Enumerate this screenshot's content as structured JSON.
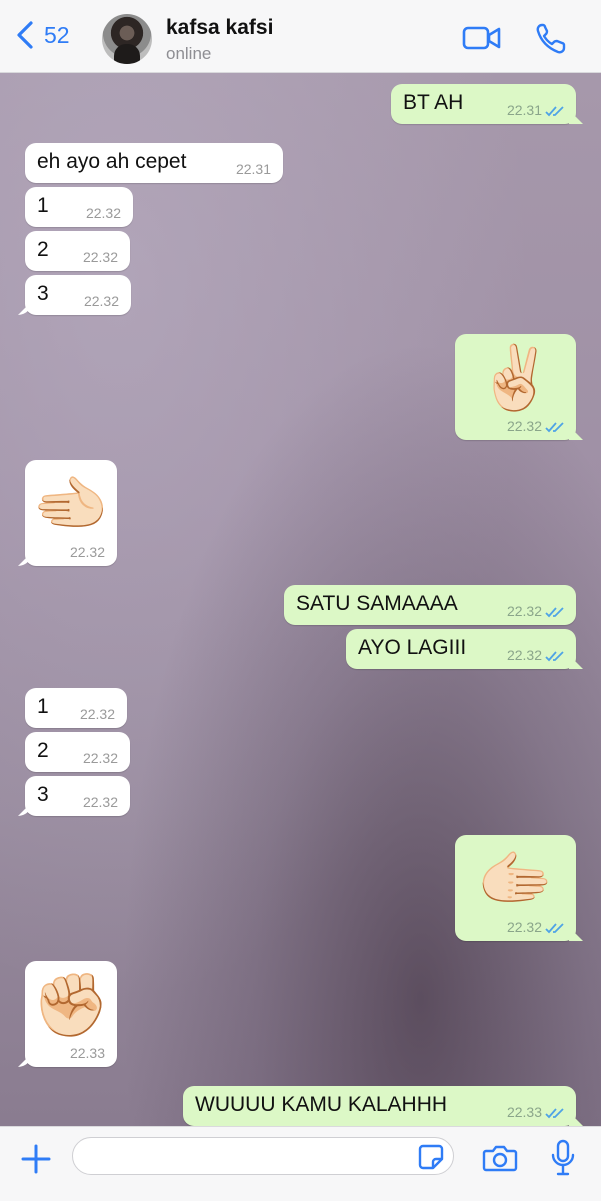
{
  "header": {
    "back_count": "52",
    "contact_name": "kafsa kafsi",
    "status": "online"
  },
  "messages": [
    {
      "dir": "out",
      "text": "BT AH",
      "time": "22.31"
    },
    {
      "dir": "in",
      "text": "eh ayo ah cepet",
      "time": "22.31"
    },
    {
      "dir": "in",
      "text": "1",
      "time": "22.32"
    },
    {
      "dir": "in",
      "text": "2",
      "time": "22.32"
    },
    {
      "dir": "in",
      "text": "3",
      "time": "22.32"
    },
    {
      "dir": "out",
      "emoji": "✌🏻",
      "time": "22.32",
      "icon": "victory-hand"
    },
    {
      "dir": "in",
      "emoji": "🫲🏻",
      "time": "22.32",
      "icon": "open-hand-paper"
    },
    {
      "dir": "out",
      "text": "SATU SAMAAAA",
      "time": "22.32"
    },
    {
      "dir": "out",
      "text": "AYO LAGIII",
      "time": "22.32"
    },
    {
      "dir": "in",
      "text": "1",
      "time": "22.32"
    },
    {
      "dir": "in",
      "text": "2",
      "time": "22.32"
    },
    {
      "dir": "in",
      "text": "3",
      "time": "22.32"
    },
    {
      "dir": "out",
      "emoji": "🫱🏻",
      "time": "22.32",
      "icon": "open-hand-paper"
    },
    {
      "dir": "in",
      "emoji": "✊🏻",
      "time": "22.33",
      "icon": "raised-fist"
    },
    {
      "dir": "out",
      "text": "WUUUU KAMU KALAHHH",
      "time": "22.33"
    }
  ],
  "colors": {
    "accent": "#2f7cf6",
    "incoming_bubble": "#ffffff",
    "outgoing_bubble": "#dcf8c6",
    "read_tick": "#4fa3e6"
  },
  "composer": {
    "placeholder": ""
  },
  "icons": [
    "back-chevron-icon",
    "video-call-icon",
    "phone-icon",
    "plus-icon",
    "sticker-icon",
    "camera-icon",
    "microphone-icon",
    "double-tick-icon"
  ]
}
